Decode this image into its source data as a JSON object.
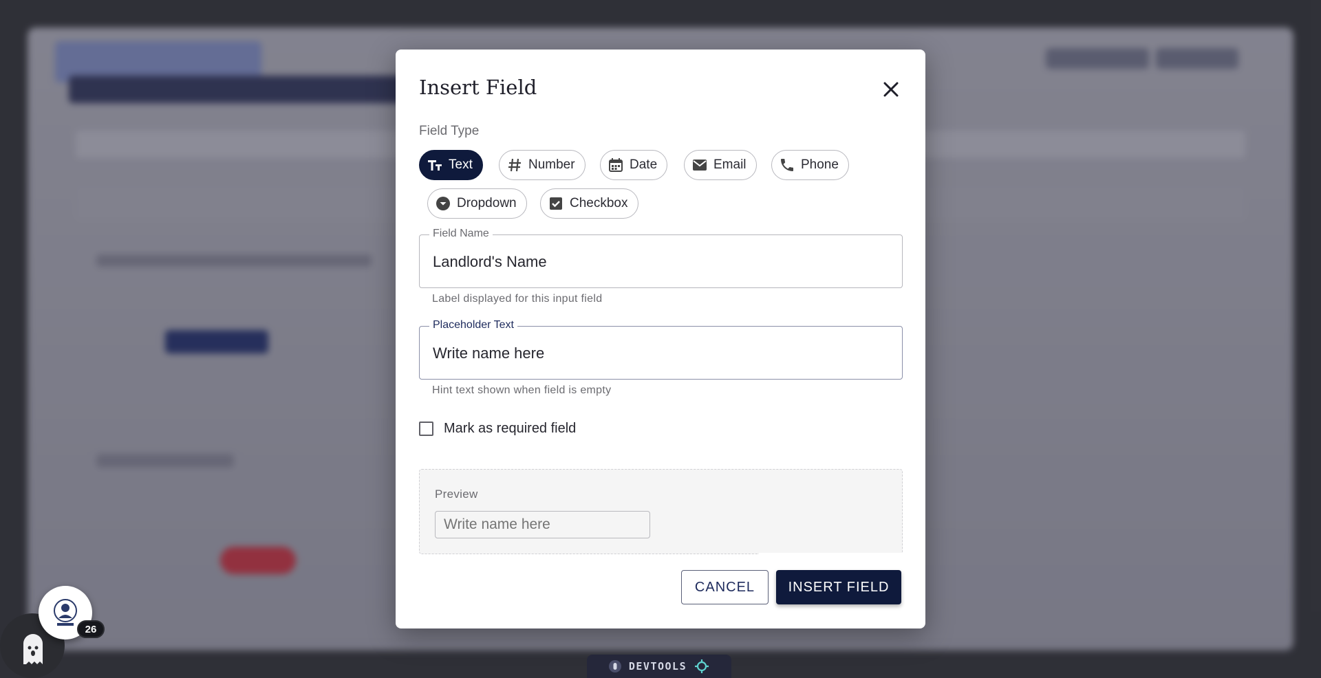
{
  "modal": {
    "title": "Insert Field",
    "field_type_label": "Field Type",
    "field_types": [
      {
        "label": "Text",
        "icon": "text-format-icon",
        "active": true
      },
      {
        "label": "Number",
        "icon": "hash-icon",
        "active": false
      },
      {
        "label": "Date",
        "icon": "calendar-icon",
        "active": false
      },
      {
        "label": "Email",
        "icon": "mail-icon",
        "active": false
      },
      {
        "label": "Phone",
        "icon": "phone-icon",
        "active": false
      },
      {
        "label": "Dropdown",
        "icon": "dropdown-circle-icon",
        "active": false
      },
      {
        "label": "Checkbox",
        "icon": "checkbox-icon",
        "active": false
      }
    ],
    "field_name": {
      "legend": "Field Name",
      "value": "Landlord's Name",
      "helper": "Label displayed for this input field"
    },
    "placeholder": {
      "legend": "Placeholder Text",
      "value": "Write name here",
      "helper": "Hint text shown when field is empty"
    },
    "required_label": "Mark as required field",
    "required_checked": false,
    "preview": {
      "label": "Preview",
      "placeholder": "Write name here"
    },
    "cancel_label": "CANCEL",
    "insert_label": "INSERT FIELD"
  },
  "widget": {
    "badge_count": "26"
  },
  "devtools": {
    "label": "DEVTOOLS"
  },
  "colors": {
    "primary": "#0f1a3c",
    "border": "#b8b8be",
    "muted_text": "#6b6b70"
  }
}
